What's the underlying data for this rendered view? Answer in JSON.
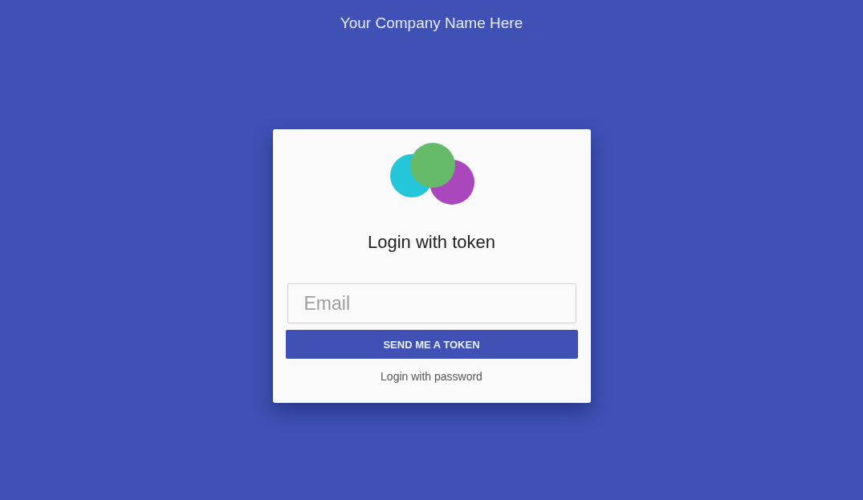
{
  "header": {
    "company_name": "Your Company Name Here"
  },
  "login_card": {
    "title": "Login with token",
    "email_field": {
      "placeholder": "Email"
    },
    "submit_button": "SEND ME A TOKEN",
    "alternate_link": "Login with password"
  }
}
